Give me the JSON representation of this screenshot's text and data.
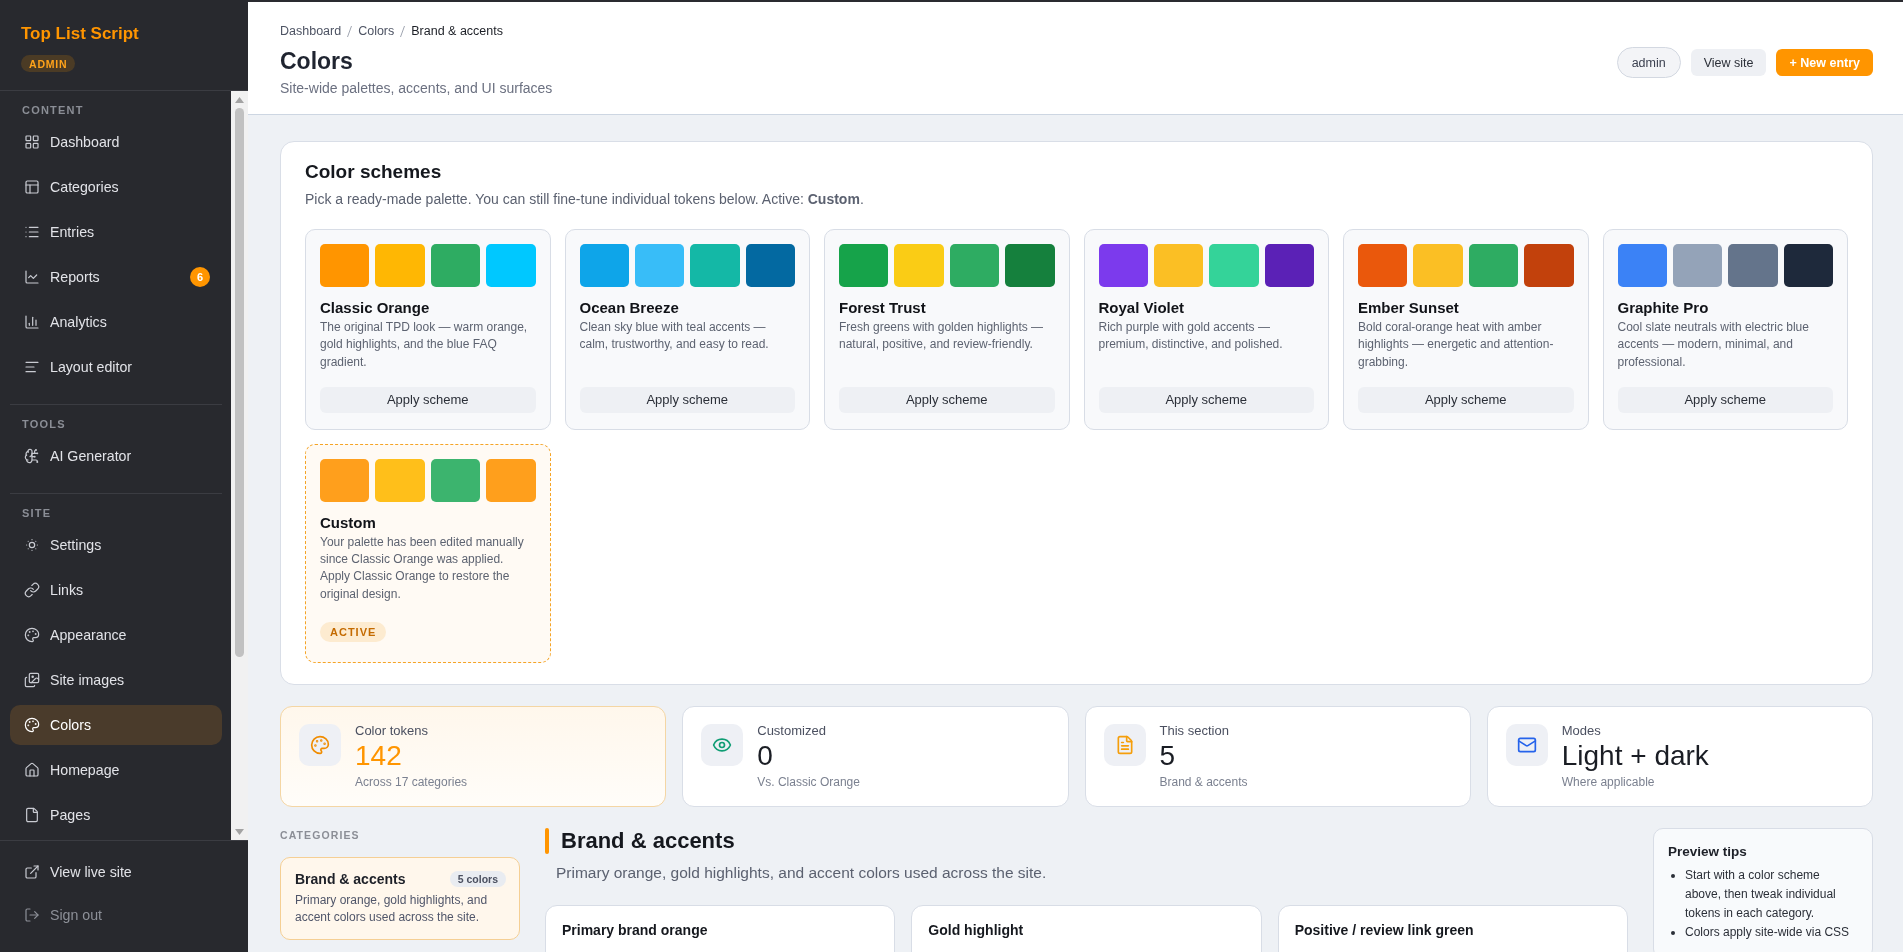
{
  "sidebar": {
    "brand": "Top List Script",
    "role_badge": "ADMIN",
    "sections": [
      {
        "title": "CONTENT",
        "items": [
          {
            "label": "Dashboard",
            "selected": false
          },
          {
            "label": "Categories",
            "selected": false
          },
          {
            "label": "Entries",
            "selected": false
          },
          {
            "label": "Reports",
            "selected": false,
            "badge": "6"
          },
          {
            "label": "Analytics",
            "selected": false
          },
          {
            "label": "Layout editor",
            "selected": false
          }
        ]
      },
      {
        "title": "TOOLS",
        "items": [
          {
            "label": "AI Generator",
            "selected": false
          }
        ]
      },
      {
        "title": "SITE",
        "items": [
          {
            "label": "Settings",
            "selected": false
          },
          {
            "label": "Links",
            "selected": false
          },
          {
            "label": "Appearance",
            "selected": false
          },
          {
            "label": "Site images",
            "selected": false
          },
          {
            "label": "Colors",
            "selected": true
          },
          {
            "label": "Homepage",
            "selected": false
          },
          {
            "label": "Pages",
            "selected": false
          }
        ]
      }
    ],
    "footer": [
      {
        "label": "View live site",
        "kind": "link"
      },
      {
        "label": "Sign out",
        "kind": "signout"
      }
    ]
  },
  "header": {
    "breadcrumb": [
      "Dashboard",
      "Colors",
      "Brand & accents"
    ],
    "title": "Colors",
    "subtitle": "Site-wide palettes, accents, and UI surfaces",
    "user": "admin",
    "actions": [
      {
        "label": "View site",
        "kind": "secondary"
      },
      {
        "label": "+ New entry",
        "kind": "primary"
      }
    ]
  },
  "color_schemes": {
    "title": "Color schemes",
    "description": "Pick a ready-made palette. You can still fine-tune individual tokens below. Active: **Custom**.",
    "schemes": [
      {
        "name": "Classic Orange",
        "description": "The original TPD look — warm orange, gold highlights, and the blue FAQ gradient.",
        "swatches": [
          {
            "color": "#ff9500"
          },
          {
            "color": "#ffb703"
          },
          {
            "color": "#2eac62"
          },
          {
            "color": "#00c8ff"
          }
        ],
        "selected": false,
        "button": "Apply scheme"
      },
      {
        "name": "Ocean Breeze",
        "description": "Clean sky blue with teal accents — calm, trustworthy, and easy to read.",
        "swatches": [
          {
            "color": "#0ea5e9"
          },
          {
            "color": "#38bdf8"
          },
          {
            "color": "#14b8a6"
          },
          {
            "color": "#0369a1"
          }
        ],
        "selected": false,
        "button": "Apply scheme"
      },
      {
        "name": "Forest Trust",
        "description": "Fresh greens with golden highlights — natural, positive, and review-friendly.",
        "swatches": [
          {
            "color": "#16a34a"
          },
          {
            "color": "#facc15"
          },
          {
            "color": "#2eac62"
          },
          {
            "color": "#15803d"
          }
        ],
        "selected": false,
        "button": "Apply scheme"
      },
      {
        "name": "Royal Violet",
        "description": "Rich purple with gold accents — premium, distinctive, and polished.",
        "swatches": [
          {
            "color": "#7c3aed"
          },
          {
            "color": "#fbbf24"
          },
          {
            "color": "#34d399"
          },
          {
            "color": "#5b21b6"
          }
        ],
        "selected": false,
        "button": "Apply scheme"
      },
      {
        "name": "Ember Sunset",
        "description": "Bold coral-orange heat with amber highlights — energetic and attention-grabbing.",
        "swatches": [
          {
            "color": "#ea580c"
          },
          {
            "color": "#fbbf24"
          },
          {
            "color": "#2eac62"
          },
          {
            "color": "#c2410c"
          }
        ],
        "selected": false,
        "button": "Apply scheme"
      },
      {
        "name": "Graphite Pro",
        "description": "Cool slate neutrals with electric blue accents — modern, minimal, and professional.",
        "swatches": [
          {
            "color": "#3b82f6"
          },
          {
            "color": "#94a3b8"
          },
          {
            "color": "#64748b"
          },
          {
            "color": "#1e293b"
          }
        ],
        "selected": false,
        "button": "Apply scheme"
      },
      {
        "name": "Custom",
        "description": "Your palette has been edited manually since Classic Orange was applied. Apply Classic Orange to restore the original design.",
        "swatches": [
          {
            "color": "#ff9f1c"
          },
          {
            "color": "#ffbf1a"
          },
          {
            "color": "#3cb46e"
          },
          {
            "color": "#ff9f1c"
          }
        ],
        "selected": true,
        "badge": "ACTIVE"
      }
    ]
  },
  "stats": [
    {
      "label": "Color tokens",
      "value": "142",
      "note": "Across 17 categories",
      "highlighted": true
    },
    {
      "label": "Customized",
      "value": "0",
      "note": "Vs. Classic Orange",
      "highlighted": false
    },
    {
      "label": "This section",
      "value": "5",
      "note": "Brand & accents",
      "highlighted": false
    },
    {
      "label": "Modes",
      "value": "Light + dark",
      "note": "Where applicable",
      "highlighted": false
    }
  ],
  "categories": {
    "title": "CATEGORIES",
    "items": [
      {
        "name": "Brand & accents",
        "count": "5 colors",
        "description": "Primary orange, gold highlights, and accent colors used across the site.",
        "selected": true
      }
    ]
  },
  "section": {
    "title": "Brand & accents",
    "subtitle": "Primary orange, gold highlights, and accent colors used across the site.",
    "tokens": [
      {
        "name": "Primary brand orange"
      },
      {
        "name": "Gold highlight"
      },
      {
        "name": "Positive / review link green"
      }
    ]
  },
  "preview_tips": {
    "title": "Preview tips",
    "tips": [
      "Start with a color scheme above, then tweak individual tokens in each category.",
      "Colors apply site-wide via CSS"
    ]
  }
}
